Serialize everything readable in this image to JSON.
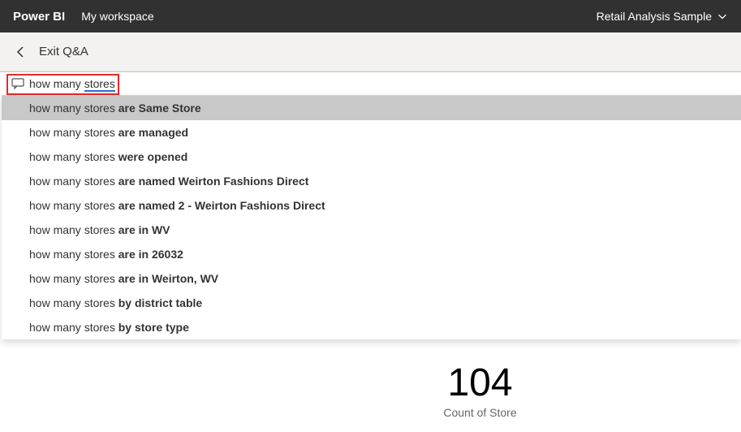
{
  "header": {
    "app_title": "Power BI",
    "workspace": "My workspace",
    "report_name": "Retail Analysis Sample"
  },
  "subheader": {
    "exit_label": "Exit Q&A"
  },
  "qna": {
    "input_base": "how many ",
    "input_underlined": "stores",
    "suggestion_base": "how many stores ",
    "suggestions": [
      {
        "completion": "are Same Store",
        "selected": true
      },
      {
        "completion": "are managed",
        "selected": false
      },
      {
        "completion": "were opened",
        "selected": false
      },
      {
        "completion": "are named Weirton Fashions Direct",
        "selected": false
      },
      {
        "completion": "are named 2 - Weirton Fashions Direct",
        "selected": false
      },
      {
        "completion": "are in WV",
        "selected": false
      },
      {
        "completion": "are in 26032",
        "selected": false
      },
      {
        "completion": "are in Weirton, WV",
        "selected": false
      },
      {
        "completion": "by district table",
        "selected": false
      },
      {
        "completion": "by store type",
        "selected": false
      }
    ]
  },
  "result": {
    "value": "104",
    "label": "Count of Store"
  }
}
